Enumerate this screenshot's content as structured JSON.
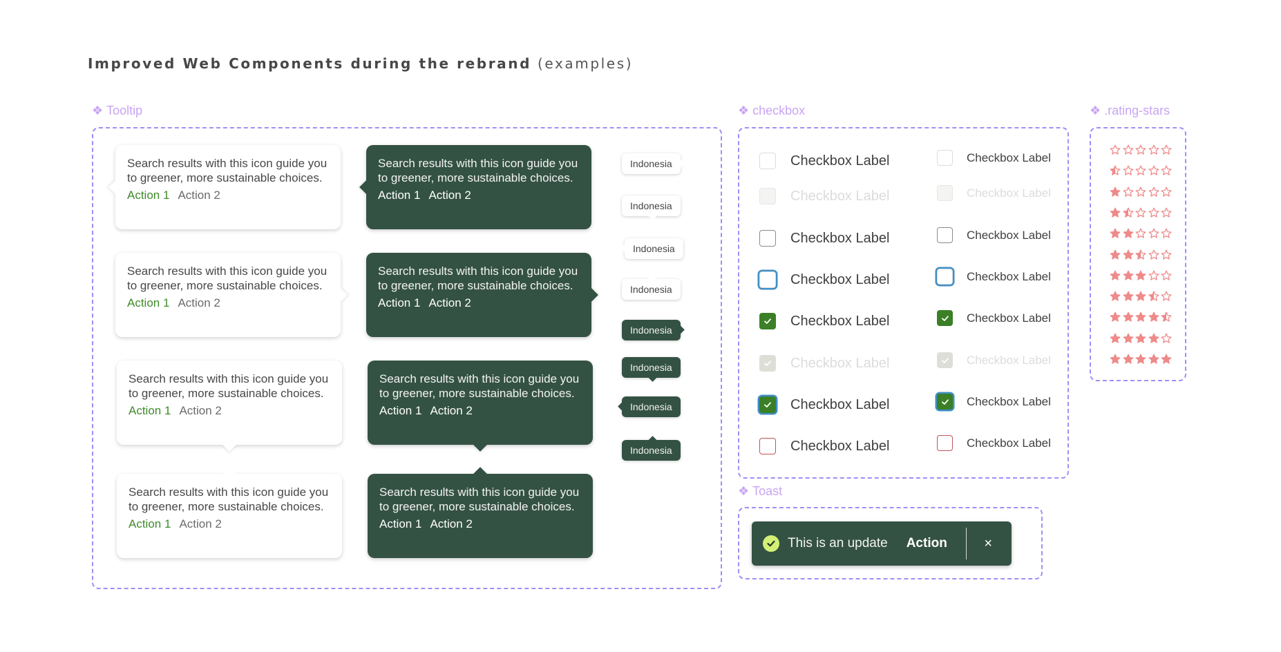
{
  "heading": {
    "bold": "Improved Web Components during the rebrand",
    "sub": "(examples)"
  },
  "sections": {
    "tooltip": {
      "icon": "component-diamond-icon",
      "label": "Tooltip"
    },
    "checkbox": {
      "icon": "component-diamond-icon",
      "label": "checkbox"
    },
    "rating": {
      "icon": "component-diamond-icon",
      "label": ".rating-stars"
    },
    "toast": {
      "icon": "component-diamond-icon",
      "label": "Toast"
    }
  },
  "tooltips": [
    {
      "theme": "light",
      "arrow": "left",
      "text": "Search results with this icon guide you to greener, more sustainable choices.",
      "action1": "Action 1",
      "action2": "Action 2"
    },
    {
      "theme": "dark",
      "arrow": "left",
      "text": "Search results with this icon guide you to greener, more sustainable choices.",
      "action1": "Action 1",
      "action2": "Action 2"
    },
    {
      "theme": "light",
      "arrow": "right",
      "text": "Search results with this icon guide you to greener, more sustainable choices.",
      "action1": "Action 1",
      "action2": "Action 2"
    },
    {
      "theme": "dark",
      "arrow": "right",
      "text": "Search results with this icon guide you to greener, more sustainable choices.",
      "action1": "Action 1",
      "action2": "Action 2"
    },
    {
      "theme": "light",
      "arrow": "down",
      "text": "Search results with this icon guide you to greener, more sustainable choices.",
      "action1": "Action 1",
      "action2": "Action 2"
    },
    {
      "theme": "dark",
      "arrow": "down",
      "text": "Search results with this icon guide you to greener, more sustainable choices.",
      "action1": "Action 1",
      "action2": "Action 2"
    },
    {
      "theme": "light",
      "arrow": "up",
      "text": "Search results with this icon guide you to greener, more sustainable choices.",
      "action1": "Action 1",
      "action2": "Action 2"
    },
    {
      "theme": "dark",
      "arrow": "up",
      "text": "Search results with this icon guide you to greener, more sustainable choices.",
      "action1": "Action 1",
      "action2": "Action 2"
    }
  ],
  "chips": [
    {
      "theme": "light",
      "arrow": "right",
      "text": "Indonesia"
    },
    {
      "theme": "light",
      "arrow": "down",
      "text": "Indonesia"
    },
    {
      "theme": "light",
      "arrow": "left",
      "text": "Indonesia"
    },
    {
      "theme": "light",
      "arrow": "up",
      "text": "Indonesia"
    },
    {
      "theme": "dark",
      "arrow": "right",
      "text": "Indonesia"
    },
    {
      "theme": "dark",
      "arrow": "down",
      "text": "Indonesia"
    },
    {
      "theme": "dark",
      "arrow": "left",
      "text": "Indonesia"
    },
    {
      "theme": "dark",
      "arrow": "up",
      "text": "Indonesia"
    }
  ],
  "checkboxes": {
    "states": [
      "default",
      "disabled",
      "hover",
      "focus",
      "checked",
      "checked-disabled",
      "checked-focus",
      "error"
    ],
    "large": [
      {
        "state": "default",
        "checked": false,
        "label": "Checkbox Label"
      },
      {
        "state": "disabled",
        "checked": false,
        "label": "Checkbox Label"
      },
      {
        "state": "hover",
        "checked": false,
        "label": "Checkbox Label"
      },
      {
        "state": "focus",
        "checked": false,
        "label": "Checkbox Label"
      },
      {
        "state": "checked",
        "checked": true,
        "label": "Checkbox Label"
      },
      {
        "state": "checked-disabled",
        "checked": true,
        "label": "Checkbox Label"
      },
      {
        "state": "checked-focus",
        "checked": true,
        "label": "Checkbox Label"
      },
      {
        "state": "error",
        "checked": false,
        "label": "Checkbox Label"
      }
    ],
    "small": [
      {
        "state": "default",
        "checked": false,
        "label": "Checkbox Label"
      },
      {
        "state": "disabled",
        "checked": false,
        "label": "Checkbox Label"
      },
      {
        "state": "hover",
        "checked": false,
        "label": "Checkbox Label"
      },
      {
        "state": "focus",
        "checked": false,
        "label": "Checkbox Label"
      },
      {
        "state": "checked",
        "checked": true,
        "label": "Checkbox Label"
      },
      {
        "state": "checked-disabled",
        "checked": true,
        "label": "Checkbox Label"
      },
      {
        "state": "checked-focus",
        "checked": true,
        "label": "Checkbox Label"
      },
      {
        "state": "error",
        "checked": false,
        "label": "Checkbox Label"
      }
    ]
  },
  "ratings": {
    "max": 5,
    "values": [
      0,
      0.5,
      1,
      1.5,
      2,
      2.5,
      3,
      3.5,
      4.5,
      4,
      5
    ]
  },
  "toast": {
    "icon": "check-circle-icon",
    "message": "This is an update",
    "action": "Action",
    "close": "×"
  },
  "colors": {
    "brand_dark": "#345244",
    "accent_green": "#3b7f27",
    "focus_blue": "#3f8fc6",
    "error_red": "#c4505a",
    "star": "#ef8a8a",
    "annotation_purple": "#a48cf5",
    "toast_icon": "#d3f075"
  }
}
